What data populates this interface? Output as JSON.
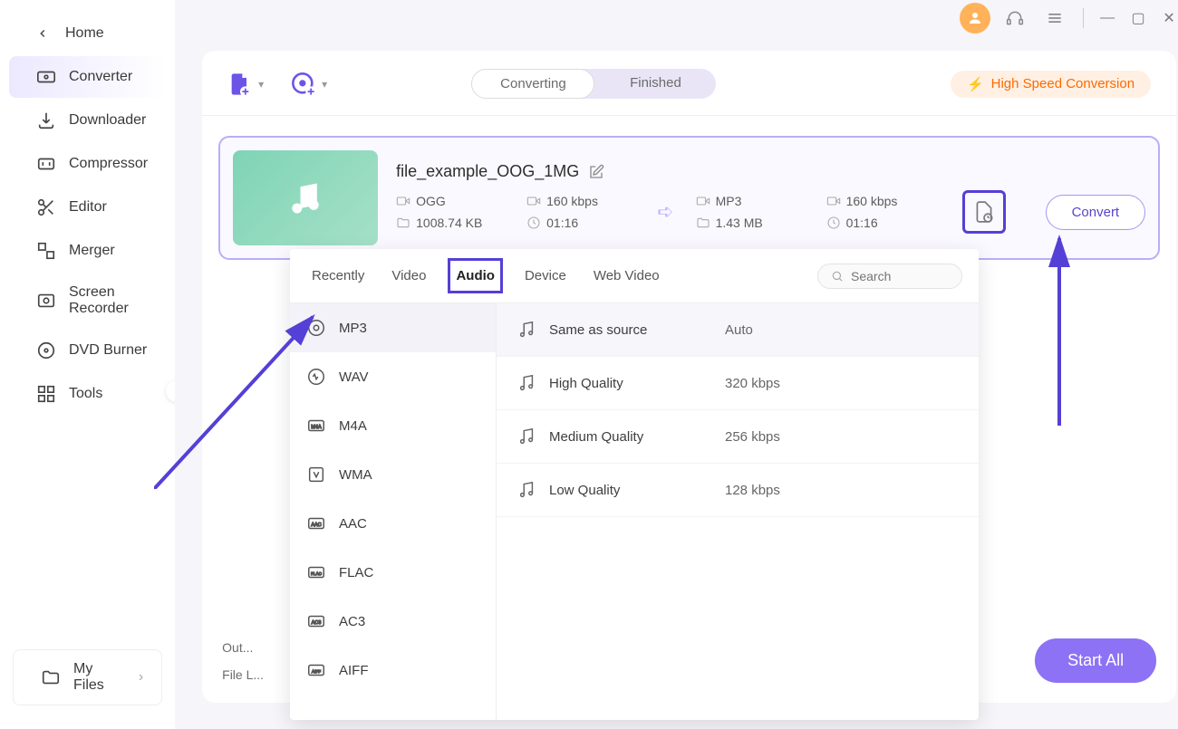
{
  "sidebar": {
    "home": "Home",
    "items": [
      {
        "label": "Converter"
      },
      {
        "label": "Downloader"
      },
      {
        "label": "Compressor"
      },
      {
        "label": "Editor"
      },
      {
        "label": "Merger"
      },
      {
        "label": "Screen Recorder"
      },
      {
        "label": "DVD Burner"
      },
      {
        "label": "Tools"
      }
    ],
    "my_files": "My Files"
  },
  "tabs": {
    "converting": "Converting",
    "finished": "Finished"
  },
  "speed_label": "High Speed Conversion",
  "file": {
    "name": "file_example_OOG_1MG",
    "src": {
      "fmt": "OGG",
      "bitrate": "160 kbps",
      "size": "1008.74 KB",
      "dur": "01:16"
    },
    "dst": {
      "fmt": "MP3",
      "bitrate": "160 kbps",
      "size": "1.43 MB",
      "dur": "01:16"
    }
  },
  "convert_label": "Convert",
  "start_all": "Start All",
  "footer": {
    "output": "Out...",
    "filel": "File L..."
  },
  "popover": {
    "tabs": [
      "Recently",
      "Video",
      "Audio",
      "Device",
      "Web Video"
    ],
    "active_tab": "Audio",
    "search_placeholder": "Search",
    "formats": [
      "MP3",
      "WAV",
      "M4A",
      "WMA",
      "AAC",
      "FLAC",
      "AC3",
      "AIFF"
    ],
    "qualities": [
      {
        "name": "Same as source",
        "rate": "Auto"
      },
      {
        "name": "High Quality",
        "rate": "320 kbps"
      },
      {
        "name": "Medium Quality",
        "rate": "256 kbps"
      },
      {
        "name": "Low Quality",
        "rate": "128 kbps"
      }
    ]
  }
}
